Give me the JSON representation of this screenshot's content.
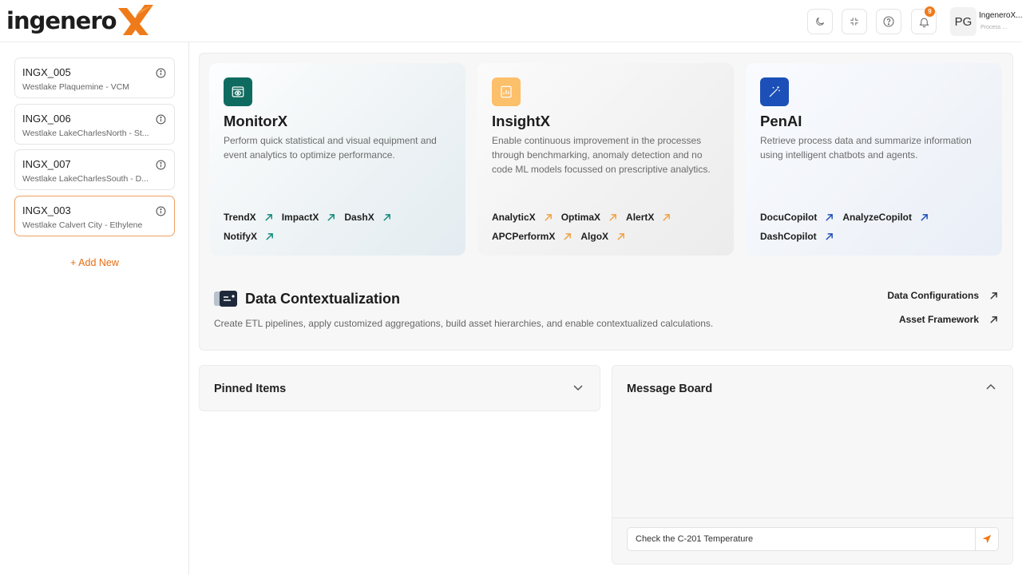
{
  "header": {
    "logo_text": "ingenero",
    "notification_count": "9",
    "user_initials": "PG",
    "user_name": "IngeneroX...",
    "user_role": "Process ..."
  },
  "sidebar": {
    "sites": [
      {
        "id": "INGX_005",
        "name": "Westlake Plaquemine - VCM"
      },
      {
        "id": "INGX_006",
        "name": "Westlake LakeCharlesNorth - St..."
      },
      {
        "id": "INGX_007",
        "name": "Westlake LakeCharlesSouth - D..."
      },
      {
        "id": "INGX_003",
        "name": "Westlake Calvert City - Ethylene"
      }
    ],
    "add_new": "+ Add New"
  },
  "cards": [
    {
      "title": "MonitorX",
      "description": "Perform quick statistical and visual equipment and event analytics to optimize performance.",
      "links": [
        "TrendX",
        "ImpactX",
        "DashX",
        "NotifyX"
      ]
    },
    {
      "title": "InsightX",
      "description": "Enable continuous improvement in the processes through benchmarking, anomaly detection and no code ML models focussed on prescriptive analytics.",
      "links": [
        "AnalyticX",
        "OptimaX",
        "AlertX",
        "APCPerformX",
        "AlgoX"
      ]
    },
    {
      "title": "PenAI",
      "description": "Retrieve process data and summarize information using intelligent chatbots and agents.",
      "links": [
        "DocuCopilot",
        "AnalyzeCopilot",
        "DashCopilot"
      ]
    }
  ],
  "data_context": {
    "title": "Data Contextualization",
    "description": "Create ETL pipelines, apply customized aggregations, build asset hierarchies, and enable contextualized calculations.",
    "link_configurations": "Data Configurations",
    "link_framework": "Asset Framework"
  },
  "pinned": {
    "title": "Pinned Items"
  },
  "message_board": {
    "title": "Message Board",
    "input_value": "Check the C-201 Temperature"
  },
  "colors": {
    "accent": "#f07a1a",
    "monitor": "#0f6b5f",
    "insight": "#fcbf6a",
    "penai": "#1c4fb8"
  }
}
